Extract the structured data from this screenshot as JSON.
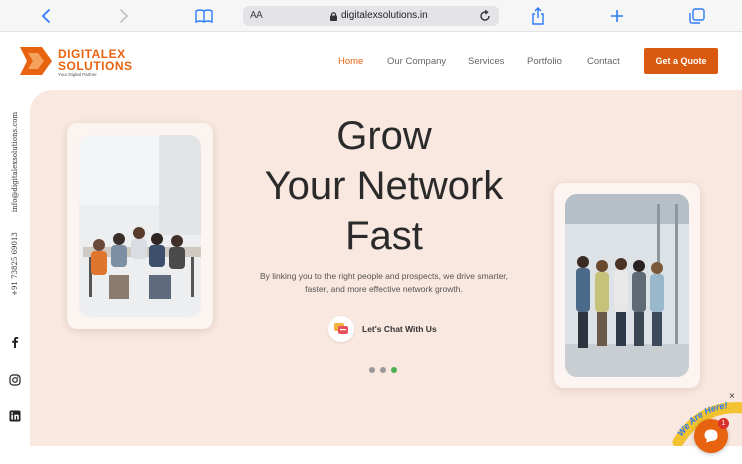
{
  "browser": {
    "aa_label": "AA",
    "url": "digitalexsolutions.in",
    "icons": [
      "back-icon",
      "forward-icon",
      "book-icon",
      "lock-icon",
      "reload-icon",
      "share-icon",
      "plus-icon",
      "tabs-icon"
    ]
  },
  "header": {
    "logo_line1": "DIGITALEX",
    "logo_line2": "SOLUTIONS",
    "logo_tagline": "Your Digital Partner",
    "nav": [
      {
        "label": "Home",
        "active": true
      },
      {
        "label": "Our Company",
        "active": false
      },
      {
        "label": "Services",
        "active": false
      },
      {
        "label": "Portfolio",
        "active": false
      },
      {
        "label": "Contact",
        "active": false
      }
    ],
    "cta_label": "Get a Quote"
  },
  "side": {
    "email": "info@digitalexsolutions.com",
    "phone": "+91 73825 69013",
    "socials": [
      "facebook-icon",
      "instagram-icon",
      "linkedin-icon"
    ]
  },
  "hero": {
    "title_line1": "Grow",
    "title_line2": "Your Network",
    "title_line3": "Fast",
    "subtitle": "By linking you to the right people and prospects, we drive smarter, faster, and more effective network growth.",
    "cta_label": "Let's Chat With Us",
    "carousel": {
      "total": 3,
      "active_index": 2
    }
  },
  "widget": {
    "ribbon_text": "We Are Here!",
    "badge_count": "1",
    "close_symbol": "×"
  },
  "colors": {
    "brand_orange": "#e8630f",
    "button_orange": "#d95a0f",
    "hero_bg": "#f9e8df",
    "link_blue": "#2f7cf6",
    "dot_active": "#4caf50"
  }
}
